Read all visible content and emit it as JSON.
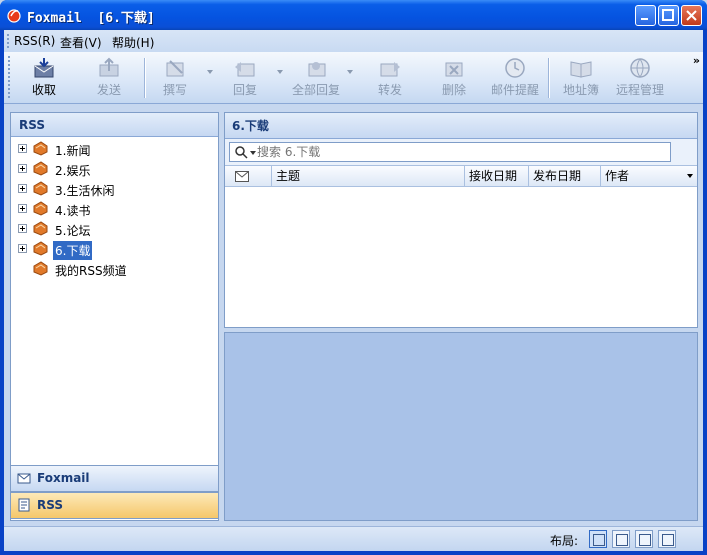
{
  "window": {
    "title": "Foxmail  [6.下载]"
  },
  "menu": [
    {
      "label": "RSS(R)"
    },
    {
      "label": "查看(V)"
    },
    {
      "label": "帮助(H)"
    }
  ],
  "toolbar": {
    "buttons": [
      {
        "label": "收取",
        "icon": "receive-icon",
        "enabled": true
      },
      {
        "label": "发送",
        "icon": "send-icon",
        "enabled": false
      },
      {
        "label": "撰写",
        "icon": "compose-icon",
        "enabled": false
      },
      {
        "label": "回复",
        "icon": "reply-icon",
        "enabled": false
      },
      {
        "label": "全部回复",
        "icon": "reply-all-icon",
        "enabled": false
      },
      {
        "label": "转发",
        "icon": "forward-icon",
        "enabled": false
      },
      {
        "label": "删除",
        "icon": "delete-icon",
        "enabled": false
      },
      {
        "label": "邮件提醒",
        "icon": "clock-icon",
        "enabled": false
      },
      {
        "label": "地址簿",
        "icon": "address-book-icon",
        "enabled": false
      },
      {
        "label": "远程管理",
        "icon": "remote-icon",
        "enabled": false
      }
    ],
    "more": "»"
  },
  "sidebar": {
    "title": "RSS",
    "items": [
      {
        "label": "1.新闻",
        "expandable": true
      },
      {
        "label": "2.娱乐",
        "expandable": true
      },
      {
        "label": "3.生活休闲",
        "expandable": true
      },
      {
        "label": "4.读书",
        "expandable": true
      },
      {
        "label": "5.论坛",
        "expandable": true
      },
      {
        "label": "6.下载",
        "expandable": true,
        "selected": true
      },
      {
        "label": "我的RSS频道",
        "expandable": false
      }
    ],
    "nav": [
      {
        "label": "Foxmail",
        "icon": "mail-icon"
      },
      {
        "label": "RSS",
        "icon": "rss-icon"
      }
    ]
  },
  "list": {
    "title": "6.下载",
    "search": {
      "placeholder": "搜索 6.下载"
    },
    "columns": [
      {
        "label": "",
        "icon": "envelope-icon"
      },
      {
        "label": "主题"
      },
      {
        "label": "接收日期"
      },
      {
        "label": "发布日期"
      },
      {
        "label": "作者"
      }
    ],
    "rows": []
  },
  "status": {
    "layout_label": "布局:"
  },
  "colors": {
    "titlebar": "#0553e0",
    "selection": "#316ac5",
    "preview_bg": "#a9c2e8",
    "rss_nav": "#f5c76a"
  }
}
